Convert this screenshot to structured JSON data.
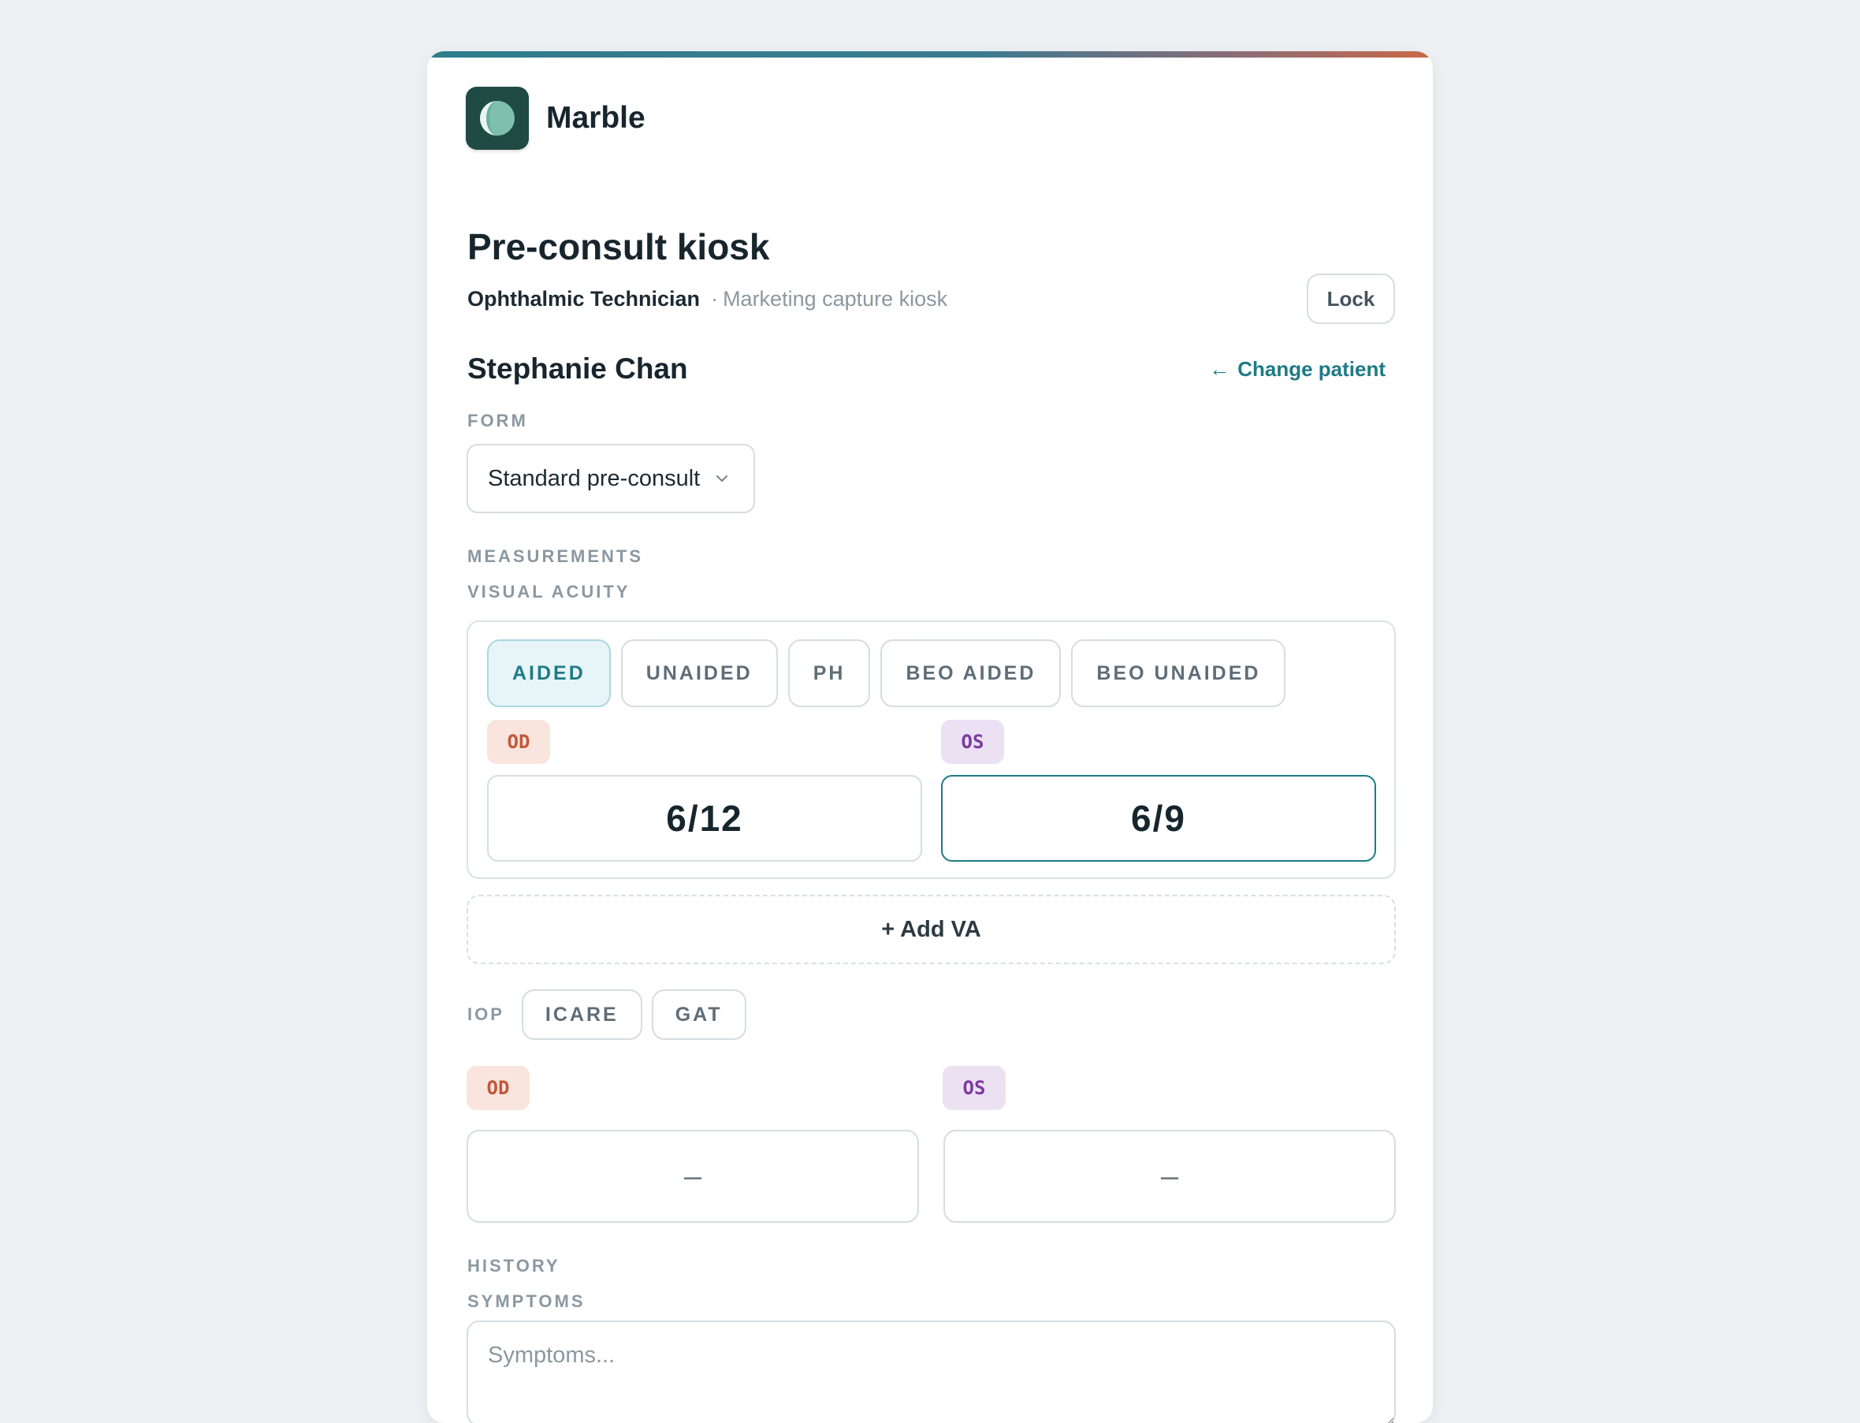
{
  "app": {
    "name": "Marble",
    "accent_color": "#1f7a86",
    "logo_icon": "marble-logo-icon"
  },
  "header": {
    "title": "Pre-consult kiosk",
    "role": "Ophthalmic Technician",
    "separator": "·",
    "mode": "Marketing capture kiosk",
    "lock_label": "Lock"
  },
  "patient": {
    "name": "Stephanie Chan",
    "change_label": "Change patient",
    "change_icon": "arrow-left-icon"
  },
  "form": {
    "label": "FORM",
    "selected": "Standard pre-consult"
  },
  "measurements": {
    "label": "MEASUREMENTS",
    "visual_acuity": {
      "label": "VISUAL ACUITY",
      "tabs": [
        "AIDED",
        "UNAIDED",
        "PH",
        "BEO AIDED",
        "BEO UNAIDED"
      ],
      "active_tab": "AIDED",
      "od_label": "OD",
      "os_label": "OS",
      "od_value": "6/12",
      "os_value": "6/9"
    },
    "add_va_label": "+ Add VA",
    "iop": {
      "label": "IOP",
      "methods": [
        "ICARE",
        "GAT"
      ],
      "od_label": "OD",
      "os_label": "OS",
      "od_value": "–",
      "os_value": "–"
    }
  },
  "history": {
    "label": "HISTORY",
    "symptoms_label": "SYMPTOMS",
    "symptoms_placeholder": "Symptoms..."
  },
  "colors": {
    "od_tag": "#c4573a",
    "os_tag": "#7c3aa0"
  }
}
